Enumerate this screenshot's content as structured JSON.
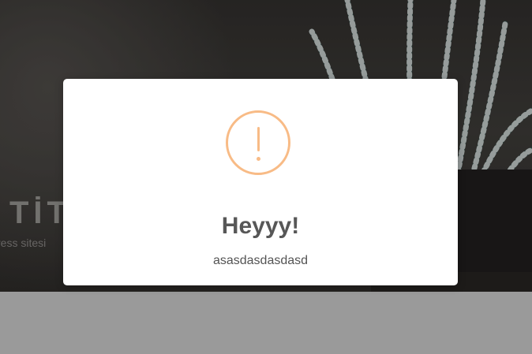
{
  "background": {
    "hero_title": "TİT",
    "hero_subtitle": "ress sitesi"
  },
  "alert": {
    "icon": "warning-exclamation-icon",
    "icon_color": "#f8bb86",
    "title": "Heyyy!",
    "text": "asasdasdasdasd"
  }
}
